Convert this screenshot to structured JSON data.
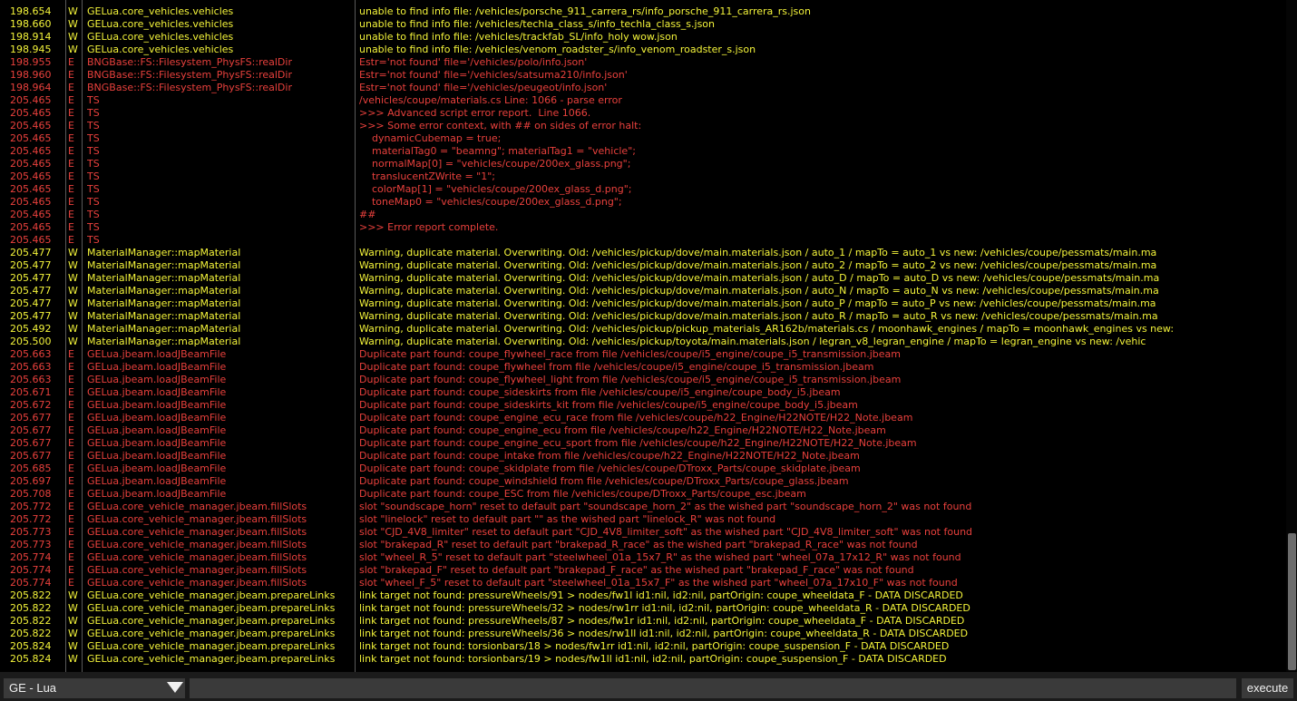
{
  "colors": {
    "warning": "#f3f33a",
    "error": "#e8403c",
    "background": "#000000",
    "bar": "#1b1b1b"
  },
  "log": [
    {
      "t": "198.654",
      "s": "W",
      "src": "GELua.core_vehicles.vehicles",
      "msg": "unable to find info file: /vehicles/porsche_911_carrera_rs/info_porsche_911_carrera_rs.json"
    },
    {
      "t": "198.660",
      "s": "W",
      "src": "GELua.core_vehicles.vehicles",
      "msg": "unable to find info file: /vehicles/techla_class_s/info_techla_class_s.json"
    },
    {
      "t": "198.914",
      "s": "W",
      "src": "GELua.core_vehicles.vehicles",
      "msg": "unable to find info file: /vehicles/trackfab_SL/info_holy wow.json"
    },
    {
      "t": "198.945",
      "s": "W",
      "src": "GELua.core_vehicles.vehicles",
      "msg": "unable to find info file: /vehicles/venom_roadster_s/info_venom_roadster_s.json"
    },
    {
      "t": "198.955",
      "s": "E",
      "src": "BNGBase::FS::Filesystem_PhysFS::realDir",
      "msg": "Estr='not found' file='/vehicles/polo/info.json'"
    },
    {
      "t": "198.960",
      "s": "E",
      "src": "BNGBase::FS::Filesystem_PhysFS::realDir",
      "msg": "Estr='not found' file='/vehicles/satsuma210/info.json'"
    },
    {
      "t": "198.964",
      "s": "E",
      "src": "BNGBase::FS::Filesystem_PhysFS::realDir",
      "msg": "Estr='not found' file='/vehicles/peugeot/info.json'"
    },
    {
      "t": "205.465",
      "s": "E",
      "src": "TS",
      "msg": "/vehicles/coupe/materials.cs Line: 1066 - parse error"
    },
    {
      "t": "205.465",
      "s": "E",
      "src": "TS",
      "msg": ">>> Advanced script error report.  Line 1066."
    },
    {
      "t": "205.465",
      "s": "E",
      "src": "TS",
      "msg": ">>> Some error context, with ## on sides of error halt:"
    },
    {
      "t": "205.465",
      "s": "E",
      "src": "TS",
      "msg": "    dynamicCubemap = true;"
    },
    {
      "t": "205.465",
      "s": "E",
      "src": "TS",
      "msg": "    materialTag0 = \"beamng\"; materialTag1 = \"vehicle\";"
    },
    {
      "t": "205.465",
      "s": "E",
      "src": "TS",
      "msg": "    normalMap[0] = \"vehicles/coupe/200ex_glass.png\";"
    },
    {
      "t": "205.465",
      "s": "E",
      "src": "TS",
      "msg": "    translucentZWrite = \"1\";"
    },
    {
      "t": "205.465",
      "s": "E",
      "src": "TS",
      "msg": "    colorMap[1] = \"vehicles/coupe/200ex_glass_d.png\";"
    },
    {
      "t": "205.465",
      "s": "E",
      "src": "TS",
      "msg": "    toneMap0 = \"vehicles/coupe/200ex_glass_d.png\";"
    },
    {
      "t": "205.465",
      "s": "E",
      "src": "TS",
      "msg": "##"
    },
    {
      "t": "205.465",
      "s": "E",
      "src": "TS",
      "msg": ">>> Error report complete."
    },
    {
      "t": "205.465",
      "s": "E",
      "src": "TS",
      "msg": ""
    },
    {
      "t": "205.477",
      "s": "W",
      "src": "MaterialManager::mapMaterial",
      "msg": "Warning, duplicate material. Overwriting. Old: /vehicles/pickup/dove/main.materials.json / auto_1 / mapTo = auto_1 vs new: /vehicles/coupe/pessmats/main.ma"
    },
    {
      "t": "205.477",
      "s": "W",
      "src": "MaterialManager::mapMaterial",
      "msg": "Warning, duplicate material. Overwriting. Old: /vehicles/pickup/dove/main.materials.json / auto_2 / mapTo = auto_2 vs new: /vehicles/coupe/pessmats/main.ma"
    },
    {
      "t": "205.477",
      "s": "W",
      "src": "MaterialManager::mapMaterial",
      "msg": "Warning, duplicate material. Overwriting. Old: /vehicles/pickup/dove/main.materials.json / auto_D / mapTo = auto_D vs new: /vehicles/coupe/pessmats/main.ma"
    },
    {
      "t": "205.477",
      "s": "W",
      "src": "MaterialManager::mapMaterial",
      "msg": "Warning, duplicate material. Overwriting. Old: /vehicles/pickup/dove/main.materials.json / auto_N / mapTo = auto_N vs new: /vehicles/coupe/pessmats/main.ma"
    },
    {
      "t": "205.477",
      "s": "W",
      "src": "MaterialManager::mapMaterial",
      "msg": "Warning, duplicate material. Overwriting. Old: /vehicles/pickup/dove/main.materials.json / auto_P / mapTo = auto_P vs new: /vehicles/coupe/pessmats/main.ma"
    },
    {
      "t": "205.477",
      "s": "W",
      "src": "MaterialManager::mapMaterial",
      "msg": "Warning, duplicate material. Overwriting. Old: /vehicles/pickup/dove/main.materials.json / auto_R / mapTo = auto_R vs new: /vehicles/coupe/pessmats/main.ma"
    },
    {
      "t": "205.492",
      "s": "W",
      "src": "MaterialManager::mapMaterial",
      "msg": "Warning, duplicate material. Overwriting. Old: /vehicles/pickup/pickup_materials_AR162b/materials.cs / moonhawk_engines / mapTo = moonhawk_engines vs new:"
    },
    {
      "t": "205.500",
      "s": "W",
      "src": "MaterialManager::mapMaterial",
      "msg": "Warning, duplicate material. Overwriting. Old: /vehicles/pickup/toyota/main.materials.json / legran_v8_legran_engine / mapTo = legran_engine vs new: /vehic"
    },
    {
      "t": "205.663",
      "s": "E",
      "src": "GELua.jbeam.loadJBeamFile",
      "msg": "Duplicate part found: coupe_flywheel_race from file /vehicles/coupe/i5_engine/coupe_i5_transmission.jbeam"
    },
    {
      "t": "205.663",
      "s": "E",
      "src": "GELua.jbeam.loadJBeamFile",
      "msg": "Duplicate part found: coupe_flywheel from file /vehicles/coupe/i5_engine/coupe_i5_transmission.jbeam"
    },
    {
      "t": "205.663",
      "s": "E",
      "src": "GELua.jbeam.loadJBeamFile",
      "msg": "Duplicate part found: coupe_flywheel_light from file /vehicles/coupe/i5_engine/coupe_i5_transmission.jbeam"
    },
    {
      "t": "205.671",
      "s": "E",
      "src": "GELua.jbeam.loadJBeamFile",
      "msg": "Duplicate part found: coupe_sideskirts from file /vehicles/coupe/i5_engine/coupe_body_i5.jbeam"
    },
    {
      "t": "205.672",
      "s": "E",
      "src": "GELua.jbeam.loadJBeamFile",
      "msg": "Duplicate part found: coupe_sideskirts_kit from file /vehicles/coupe/i5_engine/coupe_body_i5.jbeam"
    },
    {
      "t": "205.677",
      "s": "E",
      "src": "GELua.jbeam.loadJBeamFile",
      "msg": "Duplicate part found: coupe_engine_ecu_race from file /vehicles/coupe/h22_Engine/H22NOTE/H22_Note.jbeam"
    },
    {
      "t": "205.677",
      "s": "E",
      "src": "GELua.jbeam.loadJBeamFile",
      "msg": "Duplicate part found: coupe_engine_ecu from file /vehicles/coupe/h22_Engine/H22NOTE/H22_Note.jbeam"
    },
    {
      "t": "205.677",
      "s": "E",
      "src": "GELua.jbeam.loadJBeamFile",
      "msg": "Duplicate part found: coupe_engine_ecu_sport from file /vehicles/coupe/h22_Engine/H22NOTE/H22_Note.jbeam"
    },
    {
      "t": "205.677",
      "s": "E",
      "src": "GELua.jbeam.loadJBeamFile",
      "msg": "Duplicate part found: coupe_intake from file /vehicles/coupe/h22_Engine/H22NOTE/H22_Note.jbeam"
    },
    {
      "t": "205.685",
      "s": "E",
      "src": "GELua.jbeam.loadJBeamFile",
      "msg": "Duplicate part found: coupe_skidplate from file /vehicles/coupe/DTroxx_Parts/coupe_skidplate.jbeam"
    },
    {
      "t": "205.697",
      "s": "E",
      "src": "GELua.jbeam.loadJBeamFile",
      "msg": "Duplicate part found: coupe_windshield from file /vehicles/coupe/DTroxx_Parts/coupe_glass.jbeam"
    },
    {
      "t": "205.708",
      "s": "E",
      "src": "GELua.jbeam.loadJBeamFile",
      "msg": "Duplicate part found: coupe_ESC from file /vehicles/coupe/DTroxx_Parts/coupe_esc.jbeam"
    },
    {
      "t": "205.772",
      "s": "E",
      "src": "GELua.core_vehicle_manager.jbeam.fillSlots",
      "msg": "slot \"soundscape_horn\" reset to default part \"soundscape_horn_2\" as the wished part \"soundscape_horn_2\" was not found"
    },
    {
      "t": "205.772",
      "s": "E",
      "src": "GELua.core_vehicle_manager.jbeam.fillSlots",
      "msg": "slot \"linelock\" reset to default part \"\" as the wished part \"linelock_R\" was not found"
    },
    {
      "t": "205.773",
      "s": "E",
      "src": "GELua.core_vehicle_manager.jbeam.fillSlots",
      "msg": "slot \"CJD_4V8_limiter\" reset to default part \"CJD_4V8_limiter_soft\" as the wished part \"CJD_4V8_limiter_soft\" was not found"
    },
    {
      "t": "205.773",
      "s": "E",
      "src": "GELua.core_vehicle_manager.jbeam.fillSlots",
      "msg": "slot \"brakepad_R\" reset to default part \"brakepad_R_race\" as the wished part \"brakepad_R_race\" was not found"
    },
    {
      "t": "205.774",
      "s": "E",
      "src": "GELua.core_vehicle_manager.jbeam.fillSlots",
      "msg": "slot \"wheel_R_5\" reset to default part \"steelwheel_01a_15x7_R\" as the wished part \"wheel_07a_17x12_R\" was not found"
    },
    {
      "t": "205.774",
      "s": "E",
      "src": "GELua.core_vehicle_manager.jbeam.fillSlots",
      "msg": "slot \"brakepad_F\" reset to default part \"brakepad_F_race\" as the wished part \"brakepad_F_race\" was not found"
    },
    {
      "t": "205.774",
      "s": "E",
      "src": "GELua.core_vehicle_manager.jbeam.fillSlots",
      "msg": "slot \"wheel_F_5\" reset to default part \"steelwheel_01a_15x7_F\" as the wished part \"wheel_07a_17x10_F\" was not found"
    },
    {
      "t": "205.822",
      "s": "W",
      "src": "GELua.core_vehicle_manager.jbeam.prepareLinks",
      "msg": "link target not found: pressureWheels/91 > nodes/fw1l id1:nil, id2:nil, partOrigin: coupe_wheeldata_F - DATA DISCARDED"
    },
    {
      "t": "205.822",
      "s": "W",
      "src": "GELua.core_vehicle_manager.jbeam.prepareLinks",
      "msg": "link target not found: pressureWheels/32 > nodes/rw1rr id1:nil, id2:nil, partOrigin: coupe_wheeldata_R - DATA DISCARDED"
    },
    {
      "t": "205.822",
      "s": "W",
      "src": "GELua.core_vehicle_manager.jbeam.prepareLinks",
      "msg": "link target not found: pressureWheels/87 > nodes/fw1r id1:nil, id2:nil, partOrigin: coupe_wheeldata_F - DATA DISCARDED"
    },
    {
      "t": "205.822",
      "s": "W",
      "src": "GELua.core_vehicle_manager.jbeam.prepareLinks",
      "msg": "link target not found: pressureWheels/36 > nodes/rw1ll id1:nil, id2:nil, partOrigin: coupe_wheeldata_R - DATA DISCARDED"
    },
    {
      "t": "205.824",
      "s": "W",
      "src": "GELua.core_vehicle_manager.jbeam.prepareLinks",
      "msg": "link target not found: torsionbars/18 > nodes/fw1rr id1:nil, id2:nil, partOrigin: coupe_suspension_F - DATA DISCARDED"
    },
    {
      "t": "205.824",
      "s": "W",
      "src": "GELua.core_vehicle_manager.jbeam.prepareLinks",
      "msg": "link target not found: torsionbars/19 > nodes/fw1ll id1:nil, id2:nil, partOrigin: coupe_suspension_F - DATA DISCARDED"
    }
  ],
  "bottom": {
    "context_select": "GE - Lua",
    "command_value": "",
    "execute_label": "execute"
  }
}
